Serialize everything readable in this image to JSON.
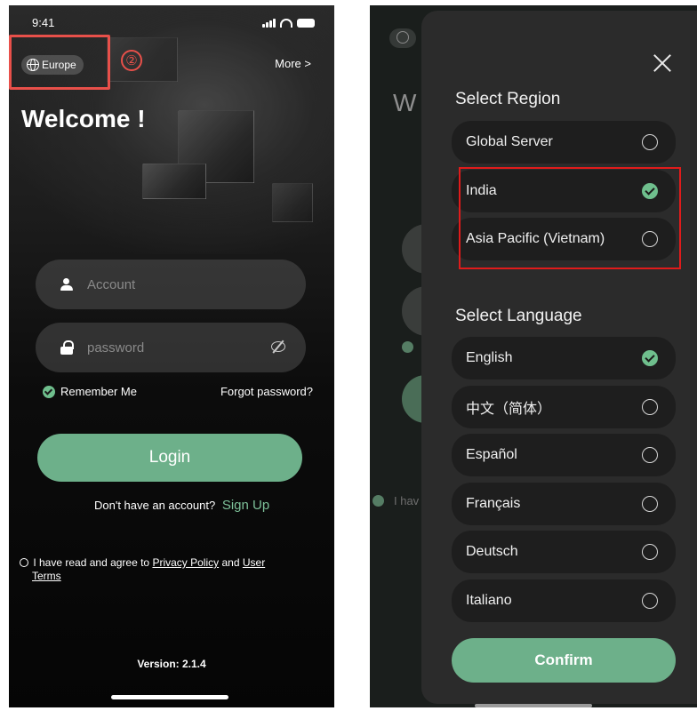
{
  "login_screen": {
    "status_time": "9:41",
    "region": "Europe",
    "step_marker": "②",
    "more_label": "More >",
    "welcome": "Welcome !",
    "account_placeholder": "Account",
    "password_placeholder": "password",
    "remember_me": "Remember Me",
    "forgot_password": "Forgot password?",
    "login_label": "Login",
    "signup_prompt": "Don't have an account?",
    "signup_link": "Sign Up",
    "agree_prefix": "I have read and agree to",
    "privacy_policy": "Privacy Policy",
    "and_word": "and",
    "user_terms_1": "User",
    "user_terms_2": "Terms",
    "version": "Version: 2.1.4"
  },
  "region_sheet": {
    "background_title_fragment": "W",
    "background_agree_fragment": "I hav",
    "region_title": "Select Region",
    "regions": [
      {
        "label": "Global Server",
        "selected": false
      },
      {
        "label": "India",
        "selected": true
      },
      {
        "label": "Asia Pacific (Vietnam)",
        "selected": false
      }
    ],
    "language_title": "Select Language",
    "languages": [
      {
        "label": "English",
        "selected": true
      },
      {
        "label": "中文（简体）",
        "selected": false
      },
      {
        "label": "Español",
        "selected": false
      },
      {
        "label": "Français",
        "selected": false
      },
      {
        "label": "Deutsch",
        "selected": false
      },
      {
        "label": "Italiano",
        "selected": false
      }
    ],
    "confirm_label": "Confirm"
  },
  "colors": {
    "accent_green": "#6db08a",
    "highlight_red": "#e01b1b"
  }
}
